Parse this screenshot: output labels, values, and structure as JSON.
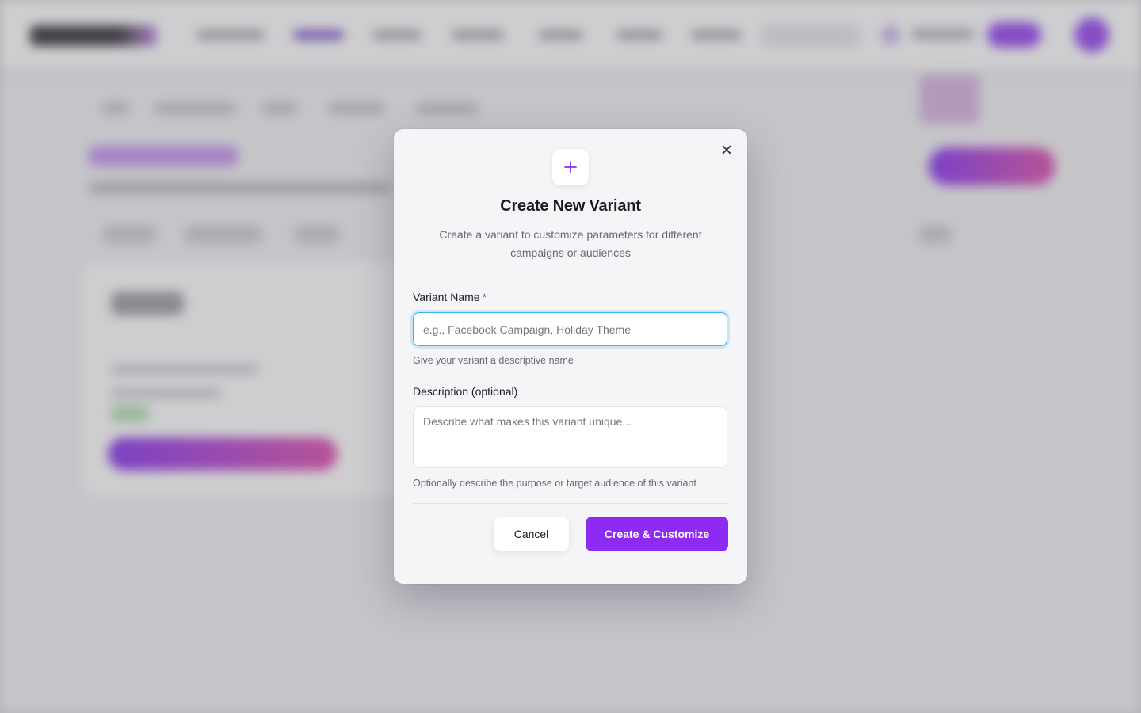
{
  "modal": {
    "title": "Create New Variant",
    "subtitle": "Create a variant to customize parameters for different campaigns or audiences",
    "close_icon": "close-icon",
    "header_icon": "plus-icon",
    "variant_name": {
      "label": "Variant Name",
      "required_marker": "*",
      "placeholder": "e.g., Facebook Campaign, Holiday Theme",
      "value": "",
      "hint": "Give your variant a descriptive name"
    },
    "description": {
      "label": "Description (optional)",
      "placeholder": "Describe what makes this variant unique...",
      "value": "",
      "hint": "Optionally describe the purpose or target audience of this variant"
    },
    "cancel_label": "Cancel",
    "submit_label": "Create & Customize"
  },
  "colors": {
    "accent": "#8e2bf3",
    "focus_ring": "#3fb3ea",
    "required": "#b23db4"
  }
}
